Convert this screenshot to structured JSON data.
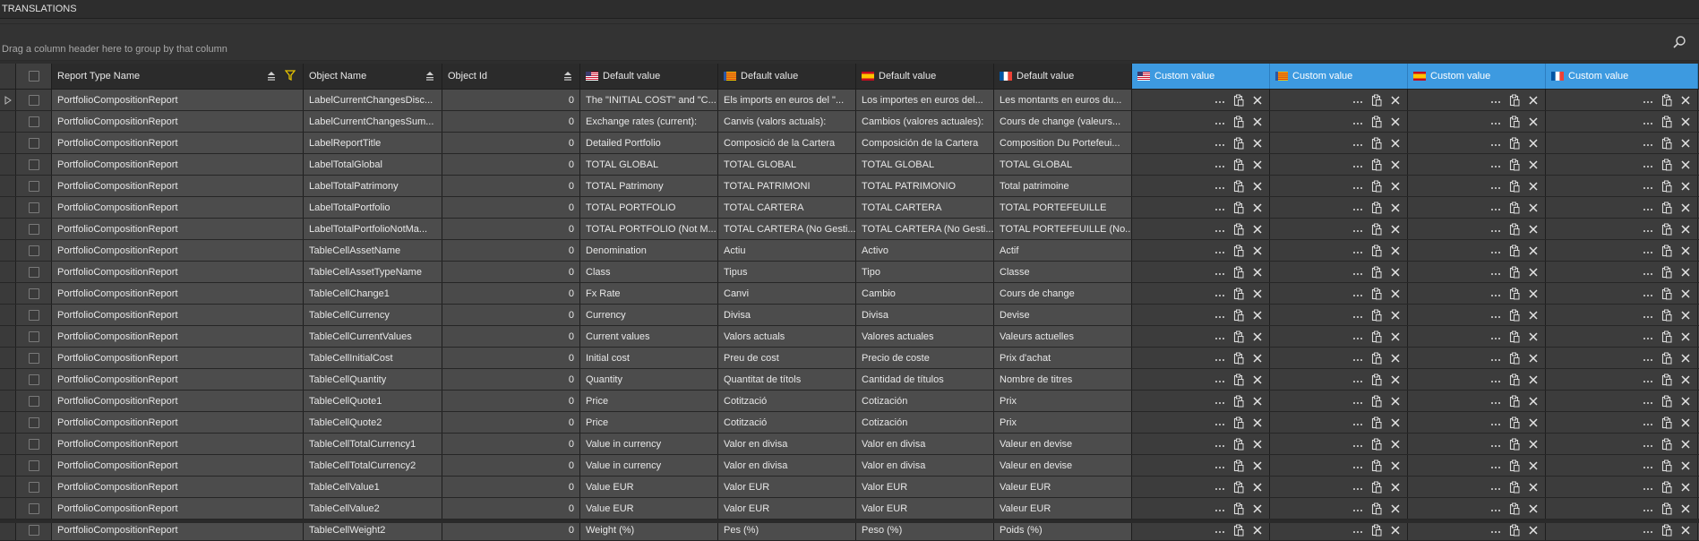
{
  "panel": {
    "title": "TRANSLATIONS"
  },
  "groupbar": {
    "hint": "Drag a column header here to group by that column",
    "icon": "search-icon"
  },
  "columns": [
    {
      "label": "Report Type Name",
      "flag": ""
    },
    {
      "label": "Object Name",
      "flag": ""
    },
    {
      "label": "Object Id",
      "flag": ""
    },
    {
      "label": "Default value",
      "flag": "us"
    },
    {
      "label": "Default value",
      "flag": "ca"
    },
    {
      "label": "Default value",
      "flag": "es"
    },
    {
      "label": "Default value",
      "flag": "fr"
    },
    {
      "label": "Custom value",
      "flag": "us"
    },
    {
      "label": "Custom value",
      "flag": "ca"
    },
    {
      "label": "Custom value",
      "flag": "es"
    },
    {
      "label": "Custom value",
      "flag": "fr"
    }
  ],
  "rows": [
    {
      "report": "PortfolioCompositionReport",
      "object": "LabelCurrentChangesDisc...",
      "id": "0",
      "en": "The \"INITIAL COST\" and \"C...",
      "ca": "Els imports en euros del \"...",
      "es": "Los importes en euros del...",
      "fr": "Les montants en euros du..."
    },
    {
      "report": "PortfolioCompositionReport",
      "object": "LabelCurrentChangesSum...",
      "id": "0",
      "en": "Exchange rates (current):",
      "ca": "Canvis (valors actuals):",
      "es": "Cambios (valores actuales):",
      "fr": "Cours de change (valeurs..."
    },
    {
      "report": "PortfolioCompositionReport",
      "object": "LabelReportTitle",
      "id": "0",
      "en": "Detailed Portfolio",
      "ca": "Composició de la Cartera",
      "es": "Composición de la Cartera",
      "fr": "Composition Du Portefeui..."
    },
    {
      "report": "PortfolioCompositionReport",
      "object": "LabelTotalGlobal",
      "id": "0",
      "en": "TOTAL GLOBAL",
      "ca": "TOTAL GLOBAL",
      "es": "TOTAL GLOBAL",
      "fr": "TOTAL GLOBAL"
    },
    {
      "report": "PortfolioCompositionReport",
      "object": "LabelTotalPatrimony",
      "id": "0",
      "en": "TOTAL Patrimony",
      "ca": "TOTAL PATRIMONI",
      "es": "TOTAL PATRIMONIO",
      "fr": "Total patrimoine"
    },
    {
      "report": "PortfolioCompositionReport",
      "object": "LabelTotalPortfolio",
      "id": "0",
      "en": "TOTAL PORTFOLIO",
      "ca": "TOTAL CARTERA",
      "es": "TOTAL CARTERA",
      "fr": "TOTAL PORTEFEUILLE"
    },
    {
      "report": "PortfolioCompositionReport",
      "object": "LabelTotalPortfolioNotMa...",
      "id": "0",
      "en": "TOTAL PORTFOLIO (Not M...",
      "ca": "TOTAL CARTERA (No Gesti...",
      "es": "TOTAL CARTERA (No Gesti...",
      "fr": "TOTAL PORTEFEUILLE (No..."
    },
    {
      "report": "PortfolioCompositionReport",
      "object": "TableCellAssetName",
      "id": "0",
      "en": "Denomination",
      "ca": "Actiu",
      "es": "Activo",
      "fr": "Actif"
    },
    {
      "report": "PortfolioCompositionReport",
      "object": "TableCellAssetTypeName",
      "id": "0",
      "en": "Class",
      "ca": "Tipus",
      "es": "Tipo",
      "fr": "Classe"
    },
    {
      "report": "PortfolioCompositionReport",
      "object": "TableCellChange1",
      "id": "0",
      "en": "Fx Rate",
      "ca": "Canvi",
      "es": "Cambio",
      "fr": "Cours de change"
    },
    {
      "report": "PortfolioCompositionReport",
      "object": "TableCellCurrency",
      "id": "0",
      "en": "Currency",
      "ca": "Divisa",
      "es": "Divisa",
      "fr": "Devise"
    },
    {
      "report": "PortfolioCompositionReport",
      "object": "TableCellCurrentValues",
      "id": "0",
      "en": "Current values",
      "ca": "Valors actuals",
      "es": "Valores actuales",
      "fr": "Valeurs actuelles"
    },
    {
      "report": "PortfolioCompositionReport",
      "object": "TableCellInitialCost",
      "id": "0",
      "en": "Initial cost",
      "ca": "Preu de cost",
      "es": "Precio de coste",
      "fr": "Prix d'achat"
    },
    {
      "report": "PortfolioCompositionReport",
      "object": "TableCellQuantity",
      "id": "0",
      "en": "Quantity",
      "ca": "Quantitat de títols",
      "es": "Cantidad de títulos",
      "fr": "Nombre de titres"
    },
    {
      "report": "PortfolioCompositionReport",
      "object": "TableCellQuote1",
      "id": "0",
      "en": "Price",
      "ca": "Cotització",
      "es": "Cotización",
      "fr": "Prix"
    },
    {
      "report": "PortfolioCompositionReport",
      "object": "TableCellQuote2",
      "id": "0",
      "en": "Price",
      "ca": "Cotització",
      "es": "Cotización",
      "fr": "Prix"
    },
    {
      "report": "PortfolioCompositionReport",
      "object": "TableCellTotalCurrency1",
      "id": "0",
      "en": "Value in currency",
      "ca": "Valor en divisa",
      "es": "Valor en divisa",
      "fr": "Valeur en devise"
    },
    {
      "report": "PortfolioCompositionReport",
      "object": "TableCellTotalCurrency2",
      "id": "0",
      "en": "Value in currency",
      "ca": "Valor en divisa",
      "es": "Valor en divisa",
      "fr": "Valeur en devise"
    },
    {
      "report": "PortfolioCompositionReport",
      "object": "TableCellValue1",
      "id": "0",
      "en": "Value EUR",
      "ca": "Valor EUR",
      "es": "Valor EUR",
      "fr": "Valeur EUR"
    },
    {
      "report": "PortfolioCompositionReport",
      "object": "TableCellValue2",
      "id": "0",
      "en": "Value EUR",
      "ca": "Valor EUR",
      "es": "Valor EUR",
      "fr": "Valeur EUR"
    },
    {
      "report": "PortfolioCompositionReport",
      "object": "TableCellWeight2",
      "id": "0",
      "en": "Weight (%)",
      "ca": "Pes (%)",
      "es": "Peso (%)",
      "fr": "Poids (%)"
    }
  ],
  "colors": {
    "accent": "#3d9ae0",
    "background": "#3b3b3b",
    "row": "#4a4a4a"
  },
  "icons": {
    "row_actions": [
      "ellipsis-icon",
      "paste-icon",
      "clear-icon"
    ],
    "sort": "sort-icon",
    "filter": "filter-icon"
  }
}
